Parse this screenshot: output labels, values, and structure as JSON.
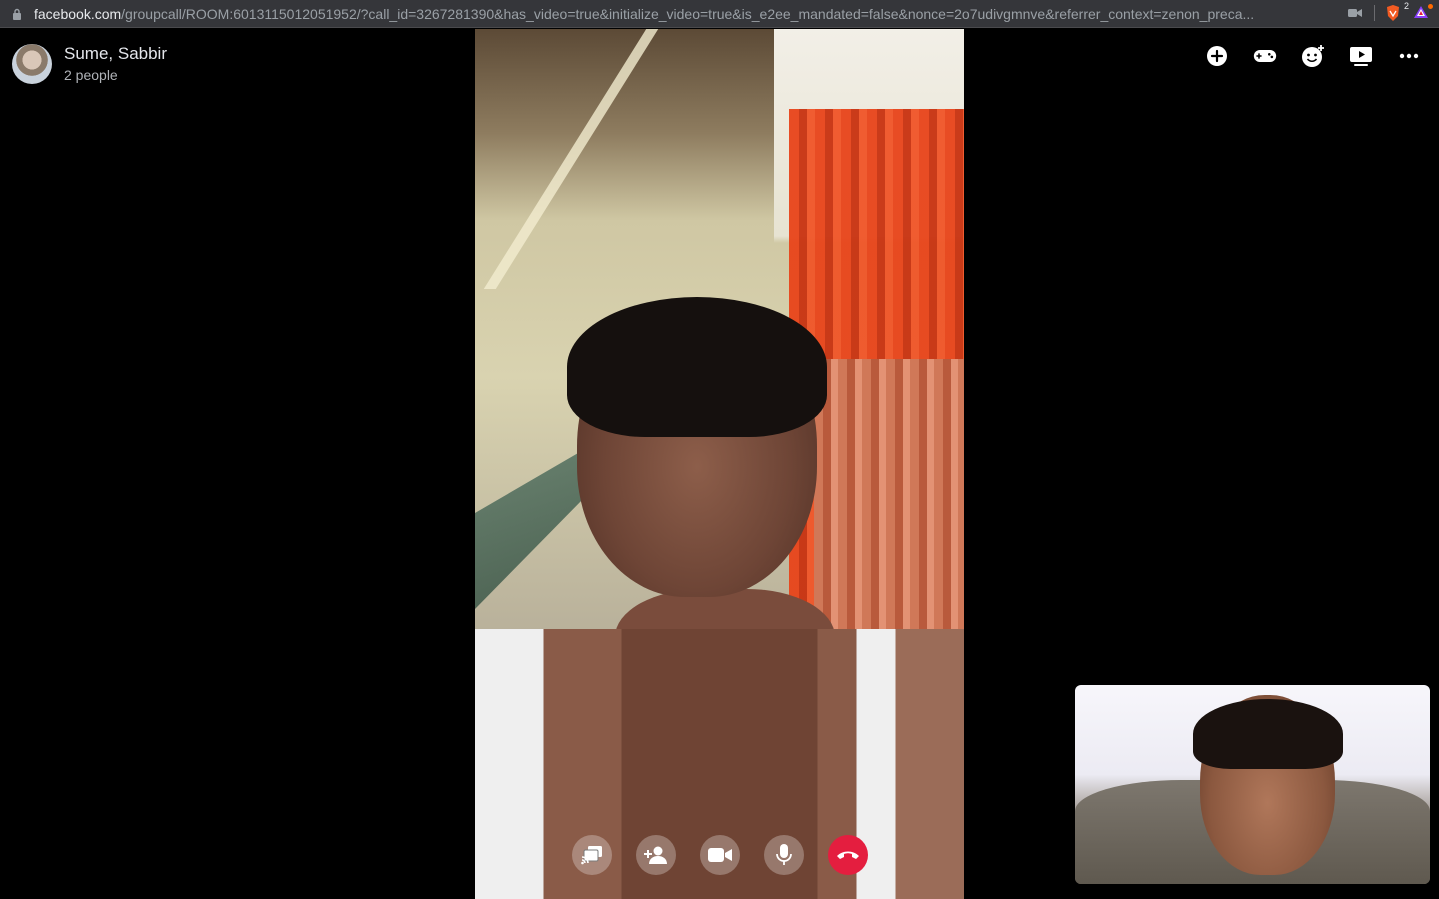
{
  "browser": {
    "url_domain": "facebook.com",
    "url_path": "/groupcall/ROOM:6013115012051952/?call_id=3267281390&has_video=true&initialize_video=true&is_e2ee_mandated=false&nonce=2o7udivgmnve&referrer_context=zenon_preca...",
    "brave_shield_count": "2",
    "icons": [
      "lock-icon",
      "camera-in-use-icon",
      "brave-shield-icon",
      "brave-rewards-icon"
    ]
  },
  "call": {
    "title": "Sume, Sabbir",
    "subtitle": "2 people"
  },
  "top_actions": [
    {
      "name": "add-icon"
    },
    {
      "name": "games-icon"
    },
    {
      "name": "add-effect-icon"
    },
    {
      "name": "watch-together-icon"
    },
    {
      "name": "more-options-icon"
    }
  ],
  "controls": [
    {
      "name": "share-screen-button"
    },
    {
      "name": "add-people-button"
    },
    {
      "name": "video-toggle-button"
    },
    {
      "name": "microphone-button"
    },
    {
      "name": "end-call-button"
    }
  ],
  "colors": {
    "end_call": "#e41e3f",
    "background": "#000000"
  }
}
